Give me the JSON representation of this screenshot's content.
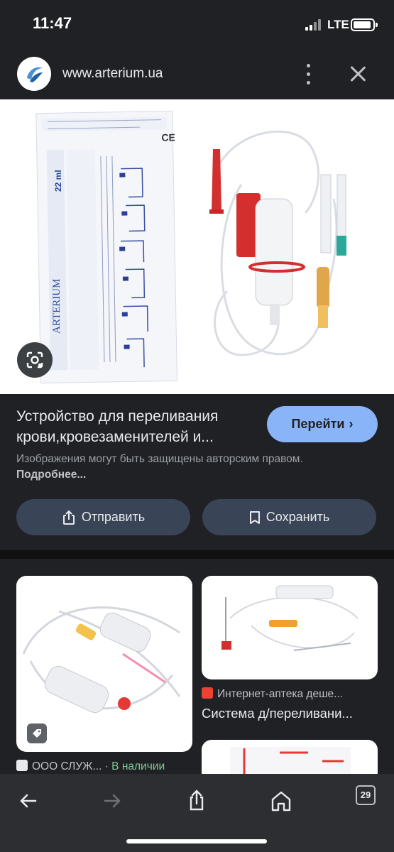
{
  "status": {
    "time": "11:47",
    "network": "LTE"
  },
  "header": {
    "url": "www.arterium.ua"
  },
  "main": {
    "title": "Устройство для переливания крови,кровезаменителей и...",
    "go_button": "Перейти",
    "copyright_text": "Изображения могут быть защищены авторским правом.",
    "copyright_link": "Подробнее...",
    "share_button": "Отправить",
    "save_button": "Сохранить"
  },
  "packaging": {
    "brand": "ARTERIUM",
    "volume": "22 ml"
  },
  "related": [
    {
      "source": "ООО СЛУЖ...",
      "availability": "· В наличии"
    },
    {
      "source": "Интернет-аптека деше...",
      "title": "Система д/переливани..."
    }
  ],
  "bottom_nav": {
    "tab_count": "29"
  },
  "colors": {
    "accent": "#8ab4f8",
    "chip": "#394457",
    "available": "#81c995"
  }
}
